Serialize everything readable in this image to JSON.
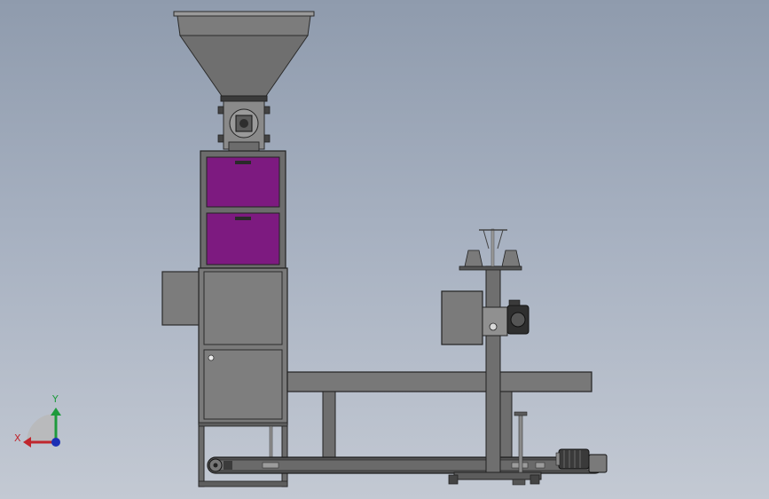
{
  "colors": {
    "background_top": "#8f9bad",
    "background_bottom": "#c3c9d3",
    "steel": "#7a7a7a",
    "steel_dark": "#5f5f5f",
    "outline": "#2b2b2b",
    "panel_purple": "#7d1a80",
    "belt": "#4a4a4a",
    "axis_x": "#c0262d",
    "axis_y": "#1e9a3c",
    "axis_z": "#1c2fb5"
  },
  "triad": {
    "x_label": "X",
    "y_label": "Y"
  }
}
